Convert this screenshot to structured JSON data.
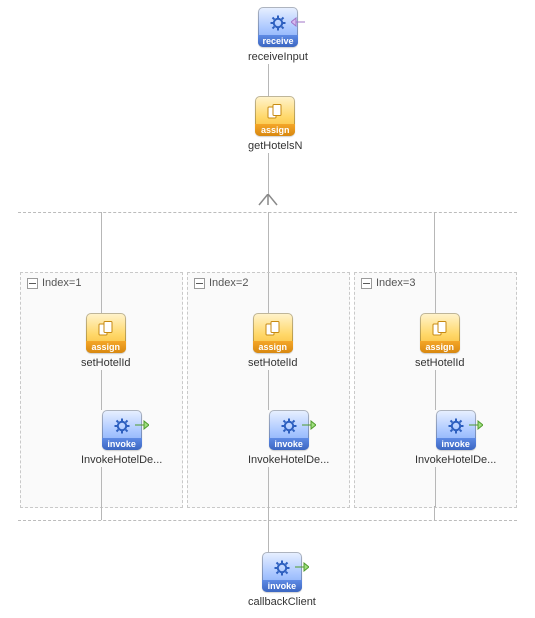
{
  "nodes": {
    "receive": {
      "label": "receiveInput",
      "caption": "receive"
    },
    "getHotels": {
      "label": "getHotelsN",
      "caption": "assign"
    },
    "callback": {
      "label": "callbackClient",
      "caption": "invoke"
    }
  },
  "branches": [
    {
      "title": "Index=1",
      "assign": {
        "label": "setHotelId",
        "caption": "assign"
      },
      "invoke": {
        "label": "InvokeHotelDe...",
        "caption": "invoke"
      }
    },
    {
      "title": "Index=2",
      "assign": {
        "label": "setHotelId",
        "caption": "assign"
      },
      "invoke": {
        "label": "InvokeHotelDe...",
        "caption": "invoke"
      }
    },
    {
      "title": "Index=3",
      "assign": {
        "label": "setHotelId",
        "caption": "assign"
      },
      "invoke": {
        "label": "InvokeHotelDe...",
        "caption": "invoke"
      }
    }
  ]
}
